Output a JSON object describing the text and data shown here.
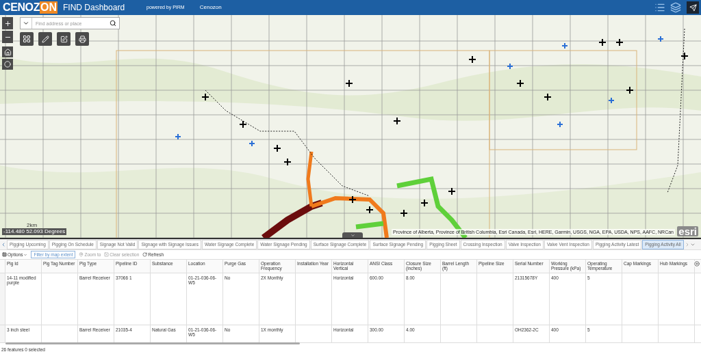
{
  "header": {
    "logo": [
      "CENOZ",
      "ON"
    ],
    "title": "FIND Dashboard",
    "powered_by": "powered by PIRM",
    "company": "Cenozon"
  },
  "map": {
    "search": {
      "placeholder": "Find address or place"
    },
    "scale": "2km",
    "coordinates": "-114.480 52.093 Degrees",
    "attribution": "Province of Alberta, Province of British Columbia, Esri Canada, Esri, HERE, Garmin, USGS, NGA, EPA, USDA, NPS, AAFC, NRCan",
    "esri": "esri"
  },
  "tabs": [
    {
      "label": "Pigging Upcoming",
      "selected": false
    },
    {
      "label": "Pigging On Schedule",
      "selected": false
    },
    {
      "label": "Signage Not Valid",
      "selected": false
    },
    {
      "label": "Signage with Signage Issues",
      "selected": false
    },
    {
      "label": "Water Signage Complete",
      "selected": false
    },
    {
      "label": "Water Signage Pending",
      "selected": false
    },
    {
      "label": "Surface Signage Complete",
      "selected": false
    },
    {
      "label": "Surface Signage Pending",
      "selected": false
    },
    {
      "label": "Pigging Sheet",
      "selected": false
    },
    {
      "label": "Crossing Inspection",
      "selected": false
    },
    {
      "label": "Valve Inspection",
      "selected": false
    },
    {
      "label": "Valve Vent Inspection",
      "selected": false
    },
    {
      "label": "Pigging Activity Latest",
      "selected": false
    },
    {
      "label": "Pigging Activity All",
      "selected": true
    }
  ],
  "toolbar": {
    "options": "Options",
    "filter": "Filter by map extent",
    "zoom_to": "Zoom to",
    "clear_selection": "Clear selection",
    "refresh": "Refresh"
  },
  "table": {
    "columns": [
      "Pig Id",
      "Pig Tag Number",
      "Pig Type",
      "Pipeline ID",
      "Substance",
      "Location",
      "Purge Gas",
      "Operation Frequency",
      "Installation Year",
      "Horizontal Vertical",
      "ANSI Class",
      "Closure Size (inches)",
      "Barrel Length (ft)",
      "Pipeline Size",
      "Serial Number",
      "Working Pressure (kPa)",
      "Operating Temperature",
      "Cap Markings",
      "Hub Markings"
    ],
    "rows": [
      [
        "14-11 modified purple",
        "",
        "Barrel Receiver",
        "37066 1",
        "",
        "01-21-036-06-W5",
        "No",
        "2X Monthly",
        "",
        "Horizontal",
        "600.00",
        "8.00",
        "",
        "",
        "21315678Y",
        "400",
        "5",
        "",
        ""
      ],
      [
        "3 inch steel",
        "",
        "Barrel Receiver",
        "21035-4",
        "Natural Gas",
        "01-21-036-06-W5",
        "No",
        "1X monthly",
        "",
        "Horizontal",
        "300.00",
        "4.00",
        "",
        "",
        "OH2362-2C",
        "400",
        "5",
        "",
        ""
      ]
    ]
  },
  "status_bar": "26 features 0 selected"
}
